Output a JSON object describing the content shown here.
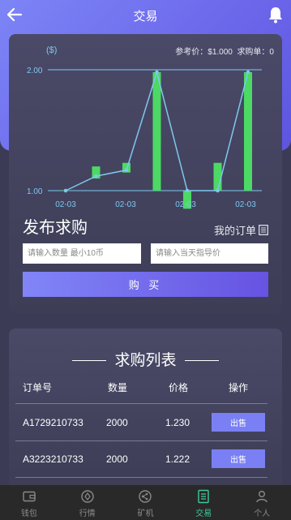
{
  "header": {
    "title": "交易"
  },
  "chart_info": {
    "reference_price": "参考价：$1.000",
    "buy_orders": "求购单：0"
  },
  "chart_data": {
    "type": "bar",
    "ylabel": "($)",
    "ylim": [
      1.0,
      2.0
    ],
    "yticks": [
      "1.00",
      "2.00"
    ],
    "x_tick_labels": [
      "02-03",
      "02-03",
      "02-03",
      "02-03"
    ],
    "bars": [
      {
        "open": 1.0,
        "close": 1.0
      },
      {
        "open": 1.1,
        "close": 1.2
      },
      {
        "open": 1.15,
        "close": 1.23
      },
      {
        "open": 1.0,
        "close": 1.98
      },
      {
        "open": 1.0,
        "close": 0.85
      },
      {
        "open": 1.0,
        "close": 1.23
      },
      {
        "open": 1.0,
        "close": 1.98
      }
    ],
    "line_values": [
      1.0,
      1.12,
      1.17,
      1.98,
      1.0,
      1.0,
      1.98
    ]
  },
  "publish": {
    "title": "发布求购",
    "my_orders": "我的订单",
    "quantity_placeholder": "请输入数量 最小10币",
    "price_placeholder": "请输入当天指导价",
    "buy_label": "购 买"
  },
  "list": {
    "title": "求购列表",
    "headers": {
      "order": "订单号",
      "qty": "数量",
      "price": "价格",
      "action": "操作"
    },
    "rows": [
      {
        "order": "A1729210733",
        "qty": "2000",
        "price": "1.230",
        "action": "出售"
      },
      {
        "order": "A3223210733",
        "qty": "2000",
        "price": "1.222",
        "action": "出售"
      }
    ]
  },
  "tabs": [
    {
      "label": "钱包",
      "icon": "wallet-icon"
    },
    {
      "label": "行情",
      "icon": "market-icon"
    },
    {
      "label": "矿机",
      "icon": "miner-icon"
    },
    {
      "label": "交易",
      "icon": "trade-icon"
    },
    {
      "label": "个人",
      "icon": "person-icon"
    }
  ],
  "colors": {
    "accent": "#6b66ea",
    "bar_up": "#4cd964",
    "line": "#7fc7ee",
    "active_tab": "#3fc89a"
  }
}
